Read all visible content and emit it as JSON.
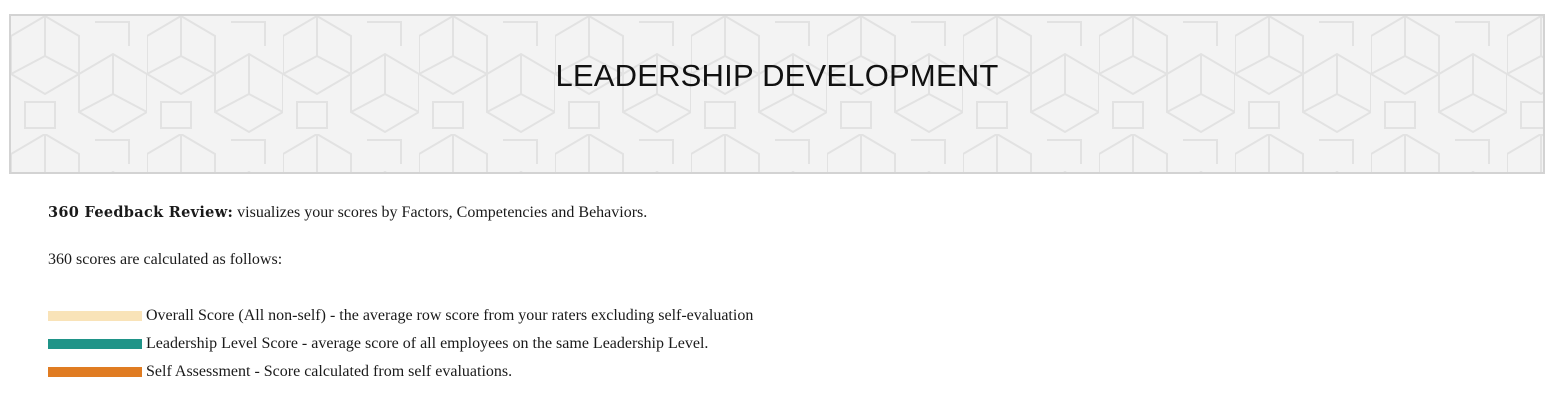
{
  "banner": {
    "title": "LEADERSHIP DEVELOPMENT"
  },
  "intro": {
    "label": "360 Feedback Review:",
    "text": " visualizes your scores by Factors, Competencies and Behaviors."
  },
  "calc_note": "360 scores are calculated as follows:",
  "legend": [
    {
      "label": "Overall Score (All non-self) - the average row score from your raters excluding self-evaluation",
      "color": "#f9e3b8"
    },
    {
      "label": "Leadership Level Score - average score of all employees on the same Leadership Level.",
      "color": "#1f9488"
    },
    {
      "label": "Self Assessment - Score calculated from self evaluations.",
      "color": "#e07c22"
    }
  ]
}
